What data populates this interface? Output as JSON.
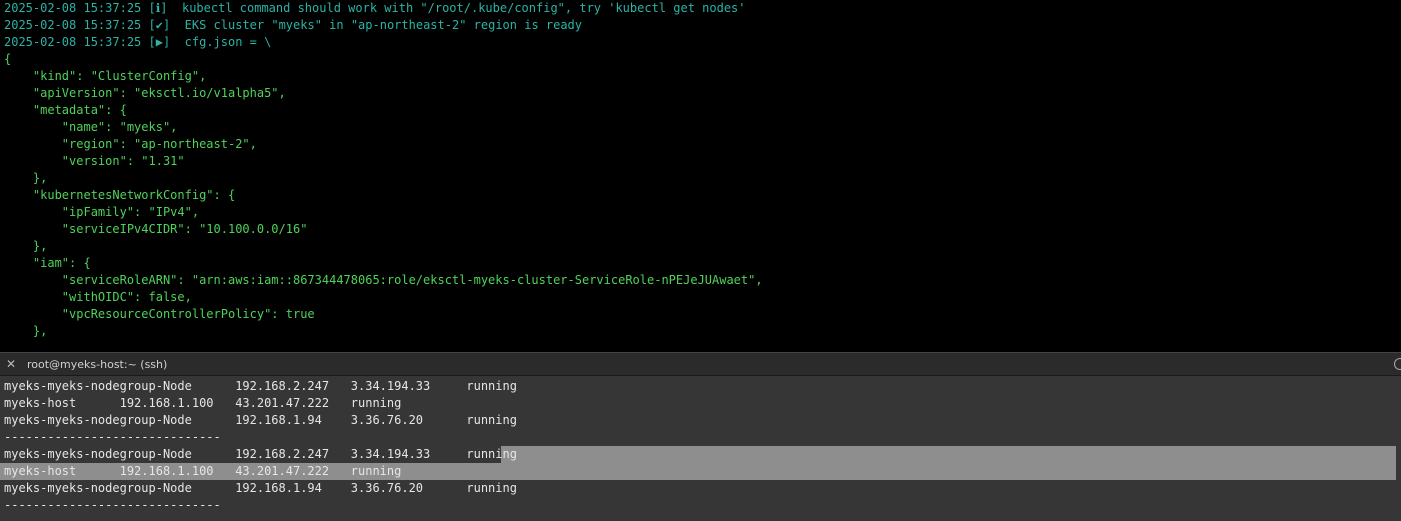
{
  "top_log": {
    "lines": [
      {
        "time": "2025-02-08 15:37:25",
        "tag": "[ℹ]",
        "msg": "kubectl command should work with \"/root/.kube/config\", try 'kubectl get nodes'"
      },
      {
        "time": "2025-02-08 15:37:25",
        "tag": "[✔]",
        "msg": "EKS cluster \"myeks\" in \"ap-northeast-2\" region is ready"
      },
      {
        "time": "2025-02-08 15:37:25",
        "tag": "[▶]",
        "msg": "cfg.json = \\"
      }
    ],
    "json_lines": [
      "{",
      "    \"kind\": \"ClusterConfig\",",
      "    \"apiVersion\": \"eksctl.io/v1alpha5\",",
      "    \"metadata\": {",
      "        \"name\": \"myeks\",",
      "        \"region\": \"ap-northeast-2\",",
      "        \"version\": \"1.31\"",
      "    },",
      "    \"kubernetesNetworkConfig\": {",
      "        \"ipFamily\": \"IPv4\",",
      "        \"serviceIPv4CIDR\": \"10.100.0.0/16\"",
      "    },",
      "    \"iam\": {",
      "        \"serviceRoleARN\": \"arn:aws:iam::867344478065:role/eksctl-myeks-cluster-ServiceRole-nPEJeJUAwaet\",",
      "        \"withOIDC\": false,",
      "        \"vpcResourceControllerPolicy\": true",
      "    },"
    ]
  },
  "pane": {
    "title": "root@myeks-host:~ (ssh)",
    "close_glyph": "✕"
  },
  "bottom_log": {
    "lines": [
      "myeks-myeks-nodegroup-Node      192.168.2.247   3.34.194.33     running",
      "myeks-host      192.168.1.100   43.201.47.222   running",
      "myeks-myeks-nodegroup-Node      192.168.1.94    3.36.76.20      running",
      "------------------------------",
      "myeks-myeks-nodegroup-Node      192.168.2.247   3.34.194.33     running",
      "myeks-host      192.168.1.100   43.201.47.222   running",
      "myeks-myeks-nodegroup-Node      192.168.1.94    3.36.76.20      running",
      "------------------------------"
    ]
  },
  "colors": {
    "top_bg": "#000000",
    "log_cyan": "#2bb3a6",
    "json_green": "#4fd25a",
    "bottom_bg": "#363636",
    "selection": "#8e8e8e"
  }
}
